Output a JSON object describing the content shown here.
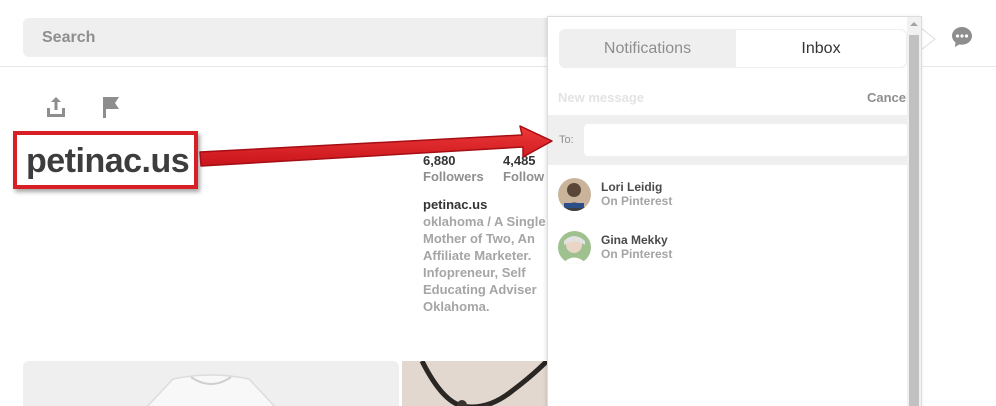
{
  "header": {
    "search_placeholder": "Search",
    "chat_icon": "speech-bubble-icon"
  },
  "profile": {
    "share_icon": "share-upload-icon",
    "flag_icon": "flag-icon",
    "name": "petinac.us",
    "followers_count": "6,880",
    "followers_label": "Followers",
    "following_count": "4,485",
    "following_label": "Follow",
    "bio_name": "petinac.us",
    "bio_text": "oklahoma / A Single\nMother of Two, An\nAffiliate Marketer.\nInfopreneur, Self\nEducating Adviser\nOklahoma."
  },
  "annotation": {
    "color": "#d81f26"
  },
  "inbox_panel": {
    "tabs": [
      {
        "label": "Notifications",
        "active": false
      },
      {
        "label": "Inbox",
        "active": true
      }
    ],
    "new_message_label": "New message",
    "cancel_label": "Cancel",
    "to_label": "To:",
    "to_value": "",
    "contacts": [
      {
        "name": "Lori Leidig",
        "subtitle": "On Pinterest"
      },
      {
        "name": "Gina Mekky",
        "subtitle": "On Pinterest"
      }
    ]
  },
  "colors": {
    "muted_text": "#8e8e8e",
    "panel_bg": "#efefef"
  }
}
